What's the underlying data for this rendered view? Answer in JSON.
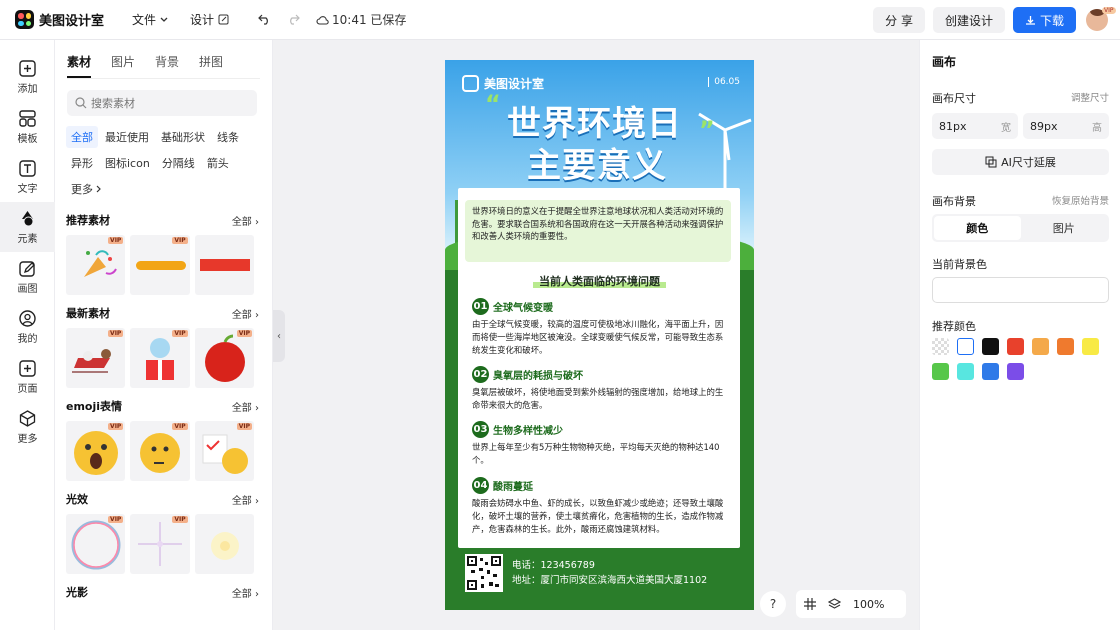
{
  "app": {
    "name": "美图设计室"
  },
  "menu": {
    "file": "文件",
    "design": "设计",
    "saved": "10:41 已保存"
  },
  "actions": {
    "share": "分 享",
    "create": "创建设计",
    "download": "下载",
    "vip": "VIP"
  },
  "nav": [
    {
      "label": "添加",
      "icon": "plus-square-icon"
    },
    {
      "label": "模板",
      "icon": "template-icon"
    },
    {
      "label": "文字",
      "icon": "text-icon"
    },
    {
      "label": "元素",
      "icon": "shapes-icon"
    },
    {
      "label": "画图",
      "icon": "pencil-icon"
    },
    {
      "label": "我的",
      "icon": "user-icon"
    },
    {
      "label": "页面",
      "icon": "page-add-icon"
    },
    {
      "label": "更多",
      "icon": "cube-icon"
    }
  ],
  "panel": {
    "tabs": [
      "素材",
      "图片",
      "背景",
      "拼图"
    ],
    "search_placeholder": "搜索素材",
    "chips": [
      "全部",
      "最近使用",
      "基础形状",
      "线条",
      "异形",
      "图标icon",
      "分隔线",
      "箭头",
      "更多"
    ],
    "sections": [
      {
        "title": "推荐素材",
        "all": "全部"
      },
      {
        "title": "最新素材",
        "all": "全部"
      },
      {
        "title": "emoji表情",
        "all": "全部"
      },
      {
        "title": "光效",
        "all": "全部"
      },
      {
        "title": "光影",
        "all": "全部"
      }
    ],
    "vip": "VIP"
  },
  "poster": {
    "brand": "美图设计室",
    "date": "06.05",
    "title_line1": "世界环境日",
    "title_line2": "主要意义",
    "intro": "世界环境日的意义在于提醒全世界注意地球状况和人类活动对环境的危害。要求联合国系统和各国政府在这一天开展各种活动来强调保护和改善人类环境的重要性。",
    "subtitle": "当前人类面临的环境问题",
    "items": [
      {
        "num": "01",
        "title": "全球气候变暖",
        "text": "由于全球气候变暖，较高的温度可使极地冰川融化，海平面上升，因而将使一些海岸地区被淹没。全球变暖使气候反常，可能导致生态系统发生变化和破坏。"
      },
      {
        "num": "02",
        "title": "臭氧层的耗损与破坏",
        "text": "臭氧层被破坏，将使地面受到紫外线辐射的强度增加，给地球上的生命带来很大的危害。"
      },
      {
        "num": "03",
        "title": "生物多样性减少",
        "text": "世界上每年至少有5万种生物物种灭绝，平均每天灭绝的物种达140个。"
      },
      {
        "num": "04",
        "title": "酸雨蔓延",
        "text": "酸雨会妨碍水中鱼、虾的成长，以致鱼虾减少或绝迹；还导致土壤酸化，破坏土壤的营养，使土壤贫瘠化，危害植物的生长，造成作物减产，危害森林的生长。此外，酸雨还腐蚀建筑材料。"
      }
    ],
    "phone": "电话：123456789",
    "address": "地址：厦门市同安区滨海西大道美国大厦1102"
  },
  "zoom": {
    "level": "100%",
    "help": "?"
  },
  "right": {
    "title": "画布",
    "size_label": "画布尺寸",
    "adjust": "调整尺寸",
    "width_value": "81px",
    "width_unit": "宽",
    "height_value": "89px",
    "height_unit": "高",
    "ai_extend": "AI尺寸延展",
    "bg_label": "画布背景",
    "restore": "恢复原始背景",
    "seg_color": "颜色",
    "seg_image": "图片",
    "current_color": "当前背景色",
    "recommend": "推荐颜色",
    "swatches": [
      "transparent",
      "#ffffff",
      "#111111",
      "#e8412c",
      "#f4a94a",
      "#ef7a2e",
      "#f8ea45",
      "#57c74a",
      "#58e6e0",
      "#2f7ae8",
      "#7b4de8"
    ]
  }
}
